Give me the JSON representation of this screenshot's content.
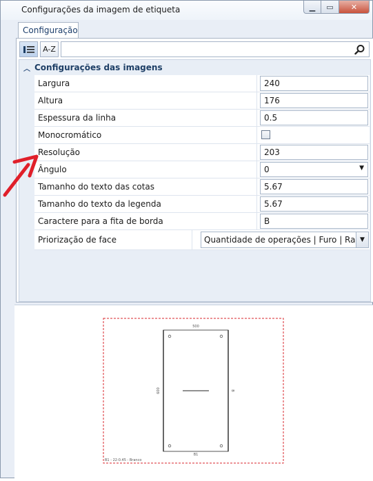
{
  "window": {
    "title": "Configurações da imagem de etiqueta",
    "min_glyph": "▁",
    "max_glyph": "▭",
    "close_glyph": "✕"
  },
  "tabs": [
    {
      "label": "Configuração"
    }
  ],
  "toolbar": {
    "sort_alpha_label": "A-Z",
    "search_value": "",
    "search_placeholder": ""
  },
  "category": {
    "label": "Configurações das imagens"
  },
  "properties": [
    {
      "label": "Largura",
      "value": "240"
    },
    {
      "label": "Altura",
      "value": "176"
    },
    {
      "label": "Espessura da linha",
      "value": "0.5"
    },
    {
      "label": "Monocromático",
      "checked": false
    },
    {
      "label": "Resolução",
      "value": "203"
    },
    {
      "label": "Ângulo",
      "value": "0"
    },
    {
      "label": "Tamanho do texto das cotas",
      "value": "5.67"
    },
    {
      "label": "Tamanho do texto da legenda",
      "value": "5.67"
    },
    {
      "label": "Caractere para a fita de borda",
      "value": "B"
    },
    {
      "label": "Priorização de face",
      "value": "Quantidade de operações | Furo | Rasgo"
    }
  ],
  "preview": {
    "top_dim": "500",
    "left_dim": "600",
    "right_edge": "B",
    "bottom_edge": "B1",
    "caption": "B1 - 22-0.45 - Branco"
  },
  "colors": {
    "accent": "#1e3f66",
    "preview_border": "#d9262b",
    "arrow": "#e01f2a"
  }
}
